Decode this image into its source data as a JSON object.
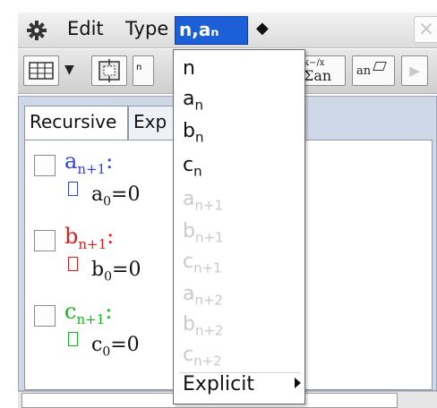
{
  "menubar": {
    "gear_icon": "gear-icon",
    "edit_label": "Edit",
    "type_label": "Type",
    "sequence_menu_label": "n,aₙ",
    "diamond_label": "◆",
    "close_label": "×"
  },
  "toolbar": {
    "dropdown_arrow": "▼",
    "partial_label": "n",
    "sum_label_top": "k−/x",
    "sum_label_bottom": "Σan",
    "an_label": "an",
    "play_label": "▶"
  },
  "tabs": [
    {
      "label": "Recursive"
    },
    {
      "label": "Exp"
    }
  ],
  "equations": [
    {
      "name": "a",
      "sub": "n+1",
      "colon": ":",
      "color": "#2f3fe0",
      "init_var": "a",
      "init_sub": "0",
      "init_rhs": "=0"
    },
    {
      "name": "b",
      "sub": "n+1",
      "colon": ":",
      "color": "#e01a1a",
      "init_var": "b",
      "init_sub": "0",
      "init_rhs": "=0"
    },
    {
      "name": "c",
      "sub": "n+1",
      "colon": ":",
      "color": "#14b81a",
      "init_var": "c",
      "init_sub": "0",
      "init_rhs": "=0"
    }
  ],
  "dropdown": {
    "items": [
      {
        "base": "n",
        "sub": "",
        "enabled": true
      },
      {
        "base": "a",
        "sub": "n",
        "enabled": true
      },
      {
        "base": "b",
        "sub": "n",
        "enabled": true
      },
      {
        "base": "c",
        "sub": "n",
        "enabled": true
      },
      {
        "base": "a",
        "sub": "n+1",
        "enabled": false
      },
      {
        "base": "b",
        "sub": "n+1",
        "enabled": false
      },
      {
        "base": "c",
        "sub": "n+1",
        "enabled": false
      },
      {
        "base": "a",
        "sub": "n+2",
        "enabled": false
      },
      {
        "base": "b",
        "sub": "n+2",
        "enabled": false
      },
      {
        "base": "c",
        "sub": "n+2",
        "enabled": false
      }
    ],
    "submenu_label": "Explicit"
  },
  "colors": {
    "menu_highlight": "#1c5fd6",
    "disabled_text": "#c9c9c9"
  }
}
